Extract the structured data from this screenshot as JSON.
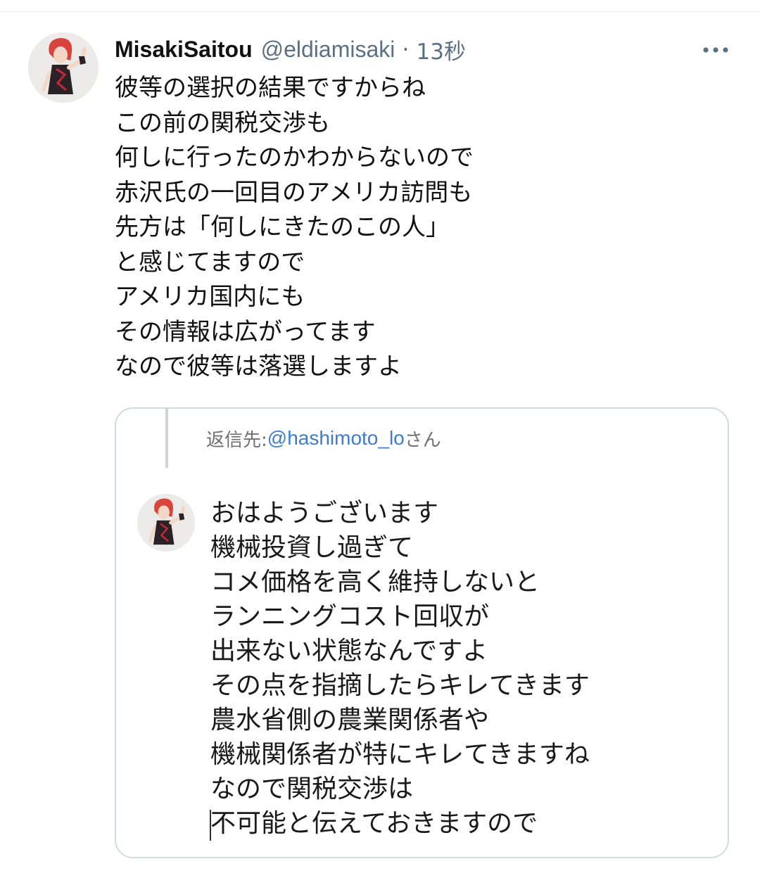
{
  "tweet": {
    "author_name": "MisakiSaitou",
    "author_handle": "@eldiamisaki",
    "separator": "·",
    "timestamp": "13秒",
    "more_icon": "more-horizontal-icon",
    "lines": [
      "彼等の選択の結果ですからね",
      "この前の関税交渉も",
      "何しに行ったのかわからないので",
      "赤沢氏の一回目のアメリカ訪問も",
      "先方は「何しにきたのこの人」",
      "と感じてますので",
      "アメリカ国内にも",
      "その情報は広がってます",
      "なので彼等は落選しますよ"
    ]
  },
  "quote": {
    "reply_prefix": "返信先: ",
    "reply_handle": "@hashimoto_lo",
    "reply_suffix": "さん",
    "lines": [
      "おはようございます",
      "機械投資し過ぎて",
      "コメ価格を高く維持しないと",
      "ランニングコスト回収が",
      "出来ない状態なんですよ",
      "その点を指摘したらキレてきます",
      "農水省側の農業関係者や",
      "機械関係者が特にキレてきますね",
      "なので関税交渉は",
      "不可能と伝えておきますので"
    ]
  },
  "colors": {
    "text": "#111111",
    "secondary": "#5b7083",
    "link": "#3f7ccb",
    "border": "#d4dade"
  }
}
